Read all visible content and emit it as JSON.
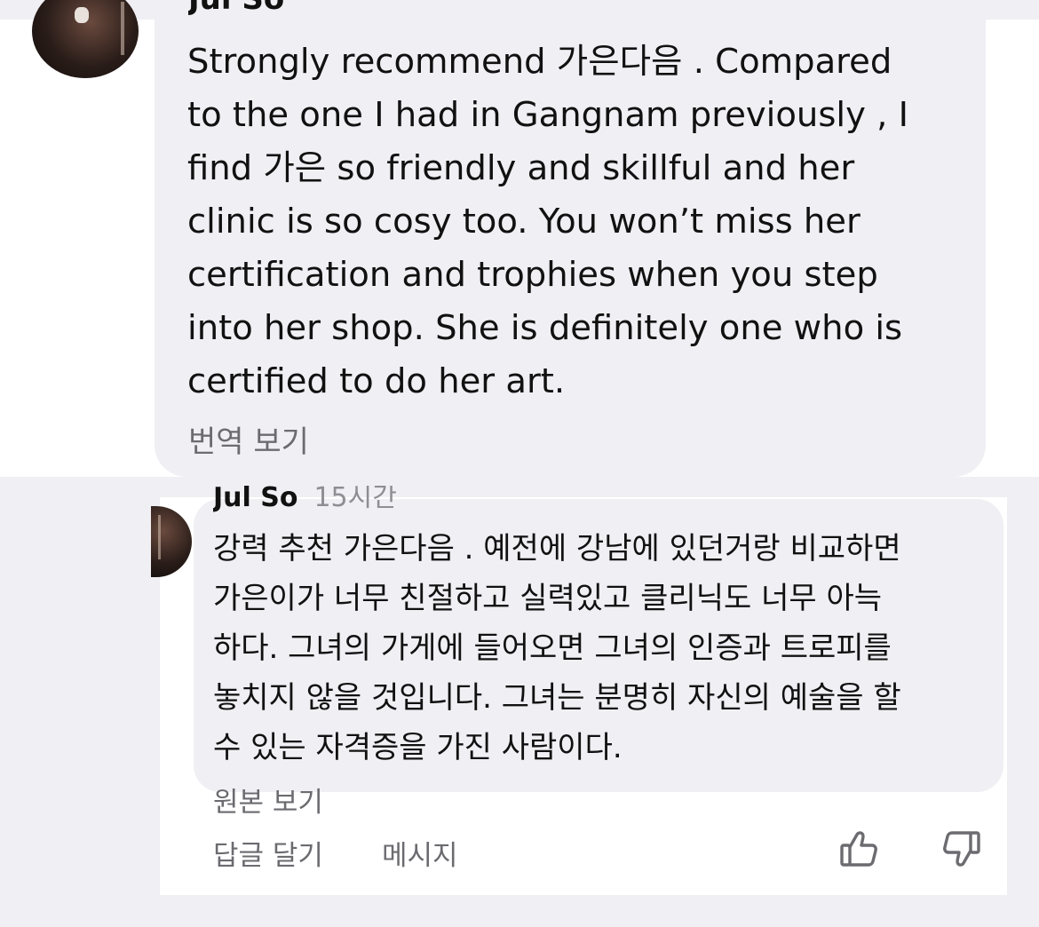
{
  "top_comment": {
    "author": "Jul So",
    "text_lines": [
      "Strongly recommend 가은다음 .  Compared",
      "to the one I had in Gangnam previously , I",
      "find 가은 so friendly and skillful and her",
      "clinic is so cosy too.  You won’t miss her",
      "certification and trophies when you step",
      "into her shop.  She is definitely one who is",
      "certified to do her art."
    ],
    "translate_label": "번역 보기"
  },
  "bottom_comment": {
    "author": "Jul So",
    "time": "15시간",
    "text_lines": [
      "강력 추천 가은다음 . 예전에 강남에 있던거랑 비교하면",
      "가은이가 너무 친절하고 실력있고 클리닉도 너무 아늑",
      "하다. 그녀의 가게에 들어오면 그녀의 인증과 트로피를",
      "놓치지 않을 것입니다. 그녀는 분명히 자신의 예술을 할",
      "수 있는 자격증을 가진 사람이다."
    ],
    "original_label": "원본 보기",
    "actions": {
      "reply_label": "답글 달기",
      "message_label": "메시지",
      "like_icon": "thumbs-up-icon",
      "dislike_icon": "thumbs-down-icon"
    }
  }
}
